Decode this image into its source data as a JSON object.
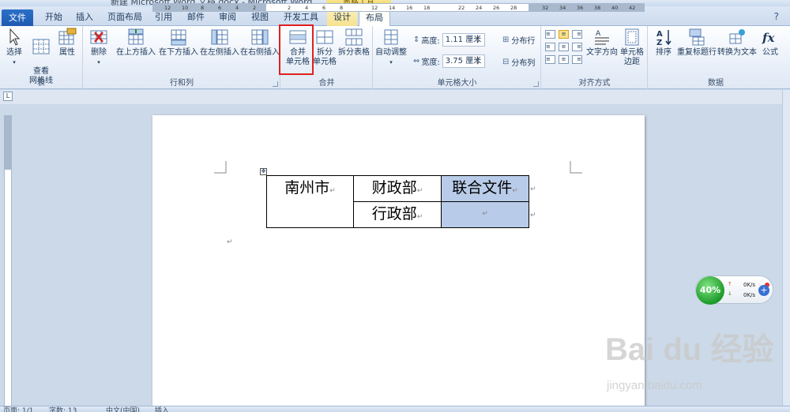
{
  "window": {
    "title": "新建 Microsoft Word 文档.docx - Microsoft Word",
    "context_tab_header": "表格工具"
  },
  "tabs": [
    {
      "label": "文件"
    },
    {
      "label": "开始"
    },
    {
      "label": "插入"
    },
    {
      "label": "页面布局"
    },
    {
      "label": "引用"
    },
    {
      "label": "邮件"
    },
    {
      "label": "审阅"
    },
    {
      "label": "视图"
    },
    {
      "label": "开发工具"
    },
    {
      "label": "设计"
    },
    {
      "label": "布局"
    }
  ],
  "ribbon": {
    "table_group": {
      "label": "表",
      "select": "选择",
      "gridlines": "查看\n网格线",
      "properties": "属性"
    },
    "rows_cols_group": {
      "label": "行和列",
      "delete": "删除",
      "insert_above": "在上方插入",
      "insert_below": "在下方插入",
      "insert_left": "在左侧插入",
      "insert_right": "在右侧插入"
    },
    "merge_group": {
      "label": "合并",
      "merge_cells_1": "合并",
      "merge_cells_2": "单元格",
      "split_cells_1": "拆分",
      "split_cells_2": "单元格",
      "split_table": "拆分表格"
    },
    "cell_size_group": {
      "label": "单元格大小",
      "autofit": "自动调整",
      "height_label": "高度:",
      "height_value": "1.11 厘米",
      "width_label": "宽度:",
      "width_value": "3.75 厘米",
      "distribute_rows": "分布行",
      "distribute_cols": "分布列"
    },
    "alignment_group": {
      "label": "对齐方式",
      "text_direction": "文字方向",
      "cell_margins_1": "单元格",
      "cell_margins_2": "边距"
    },
    "data_group": {
      "label": "数据",
      "sort": "排序",
      "repeat_header": "重复标题行",
      "convert_to_text": "转换为文本",
      "formula": "公式"
    }
  },
  "ruler": {
    "ticks": [
      "12",
      "10",
      "8",
      "6",
      "4",
      "2",
      "",
      "2",
      "4",
      "6",
      "8",
      "",
      "12",
      "14",
      "16",
      "18",
      "",
      "22",
      "24",
      "26",
      "28",
      "",
      "32",
      "34",
      "36",
      "38",
      "40",
      "42"
    ]
  },
  "document": {
    "table": {
      "r1c1": "南州市",
      "r1c2": "财政部",
      "r1c3": "联合文件",
      "r2c2": "行政部"
    }
  },
  "speed_widget": {
    "percent": "40%",
    "up": "0K/s",
    "down": "0K/s"
  },
  "watermark": {
    "brand": "Bai du 经验",
    "url": "jingyan.baidu.com"
  },
  "status_bar": {
    "page": "页面: 1/1",
    "words": "字数: 13",
    "language": "中文(中国)",
    "mode": "插入"
  }
}
